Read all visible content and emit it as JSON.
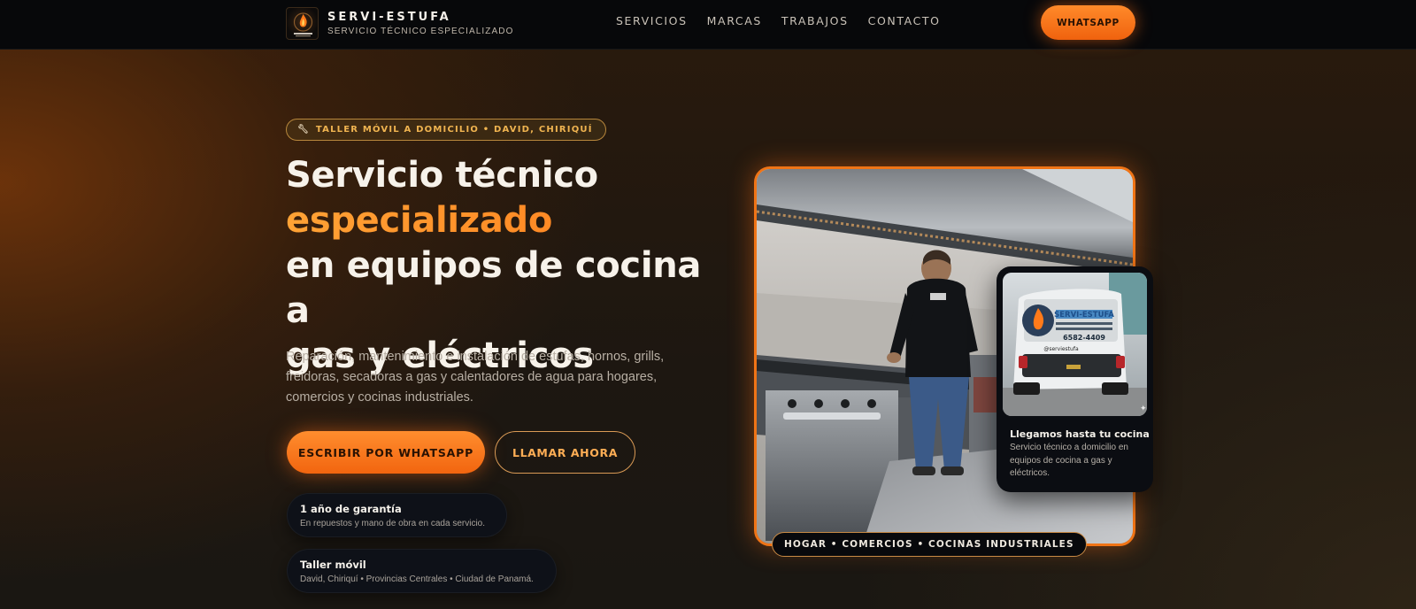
{
  "nav": {
    "brand_name": "SERVI-ESTUFA",
    "brand_tagline": "SERVICIO TÉCNICO ESPECIALIZADO",
    "menu": [
      "SERVICIOS",
      "MARCAS",
      "TRABAJOS",
      "CONTACTO"
    ],
    "cta": "WHATSAPP"
  },
  "hero": {
    "badge": "TALLER MÓVIL A DOMICILIO • DAVID, CHIRIQUÍ",
    "badge_icon": "wrench-icon",
    "headline_line1": "Servicio técnico",
    "headline_accent": "especializado",
    "headline_line3": "en equipos de cocina a",
    "headline_line4": "gas y eléctricos",
    "lead": "Reparación, mantenimiento e instalación de estufas, hornos, grills, freidoras, secadoras a gas y calentadores de agua para hogares, comercios y cocinas industriales.",
    "primary_button": "ESCRIBIR POR WHATSAPP",
    "secondary_button": "LLAMAR AHORA",
    "features": [
      {
        "title": "1 año de garantía",
        "desc": "En repuestos y mano de obra en cada servicio."
      },
      {
        "title": "Taller móvil",
        "desc": "David, Chiriquí • Provincias Centrales • Ciudad de Panamá."
      }
    ]
  },
  "photo": {
    "chip": "HOGAR • COMERCIOS • COCINAS INDUSTRIALES",
    "card_title": "Llegamos hasta tu cocina",
    "card_desc": "Servicio técnico a domicilio en equipos de cocina a gas y eléctricos.",
    "van_brand": "SERVI-ESTUFA",
    "van_phone": "6582-4409",
    "van_handle": "@serviestufa"
  },
  "colors": {
    "accent": "#f2650f",
    "accent_light": "#ff8d2e",
    "nav_bg": "#07080a",
    "card_bg": "#0e1118"
  }
}
